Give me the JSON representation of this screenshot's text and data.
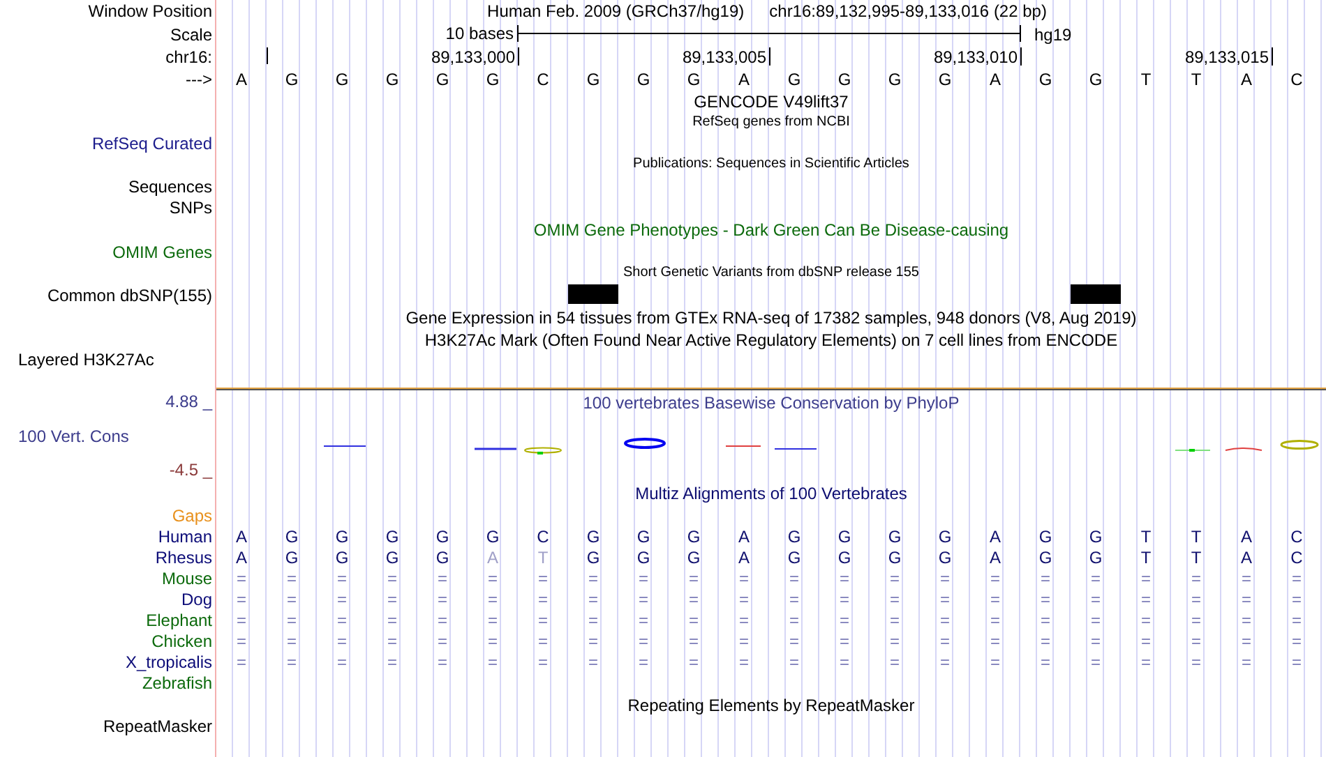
{
  "position_row": {
    "label": "Window Position",
    "assembly": "Human Feb. 2009 (GRCh37/hg19)",
    "range": "chr16:89,132,995-89,133,016 (22 bp)"
  },
  "scale_row": {
    "label": "Scale",
    "length": "10 bases",
    "assembly": "hg19"
  },
  "coordinate_row": {
    "label": "chr16:",
    "ticks": [
      "89,133,000",
      "89,133,005",
      "89,133,010",
      "89,133,015"
    ]
  },
  "sequence_row": {
    "label": "--->",
    "bases": [
      "A",
      "G",
      "G",
      "G",
      "G",
      "G",
      "C",
      "G",
      "G",
      "G",
      "A",
      "G",
      "G",
      "G",
      "G",
      "A",
      "G",
      "G",
      "T",
      "T",
      "A",
      "C"
    ]
  },
  "tracks": [
    {
      "kind": "title",
      "title": "GENCODE V49lift37",
      "color": "#000000"
    },
    {
      "kind": "small-title",
      "title": "RefSeq genes from NCBI",
      "color": "#000000"
    },
    {
      "kind": "label",
      "label": "RefSeq Curated",
      "color": "#1c1c8c"
    },
    {
      "kind": "small-title",
      "title": "Publications: Sequences in Scientific Articles",
      "color": "#000000"
    },
    {
      "kind": "label",
      "label": "Sequences",
      "color": "#000000"
    },
    {
      "kind": "label",
      "label": "SNPs",
      "color": "#000000"
    },
    {
      "kind": "title",
      "title": "OMIM Gene Phenotypes - Dark Green Can Be Disease-causing",
      "color": "#0c6a0c"
    },
    {
      "kind": "label",
      "label": "OMIM Genes",
      "color": "#0c6a0c"
    },
    {
      "kind": "small-title",
      "title": "Short Genetic Variants from dbSNP release 155",
      "color": "#000000"
    },
    {
      "kind": "variants",
      "label": "Common dbSNP(155)",
      "color": "#000000"
    },
    {
      "kind": "title",
      "title": "Gene Expression in 54 tissues from GTEx RNA-seq of 17382 samples, 948 donors (V8, Aug 2019)",
      "color": "#000000"
    },
    {
      "kind": "title",
      "title": "H3K27Ac Mark (Often Found Near Active Regulatory Elements) on 7 cell lines from ENCODE",
      "color": "#000000"
    },
    {
      "kind": "layered",
      "label": "Layered H3K27Ac",
      "color": "#000000"
    },
    {
      "kind": "axis-max",
      "label": "4.88 _",
      "title": "100 vertebrates Basewise Conservation by PhyloP",
      "color": "#3c3c8c"
    },
    {
      "kind": "conservation",
      "label": "100 Vert. Cons",
      "color": "#3c3c8c"
    },
    {
      "kind": "axis-min",
      "label": "-4.5 _",
      "color": "#8b3a3a"
    },
    {
      "kind": "title",
      "title": "Multiz Alignments of 100 Vertebrates",
      "color": "#0c0c70"
    },
    {
      "kind": "label",
      "label": "Gaps",
      "color": "#e8901c"
    },
    {
      "kind": "alignment",
      "label": "Human",
      "color": "#0c0c78",
      "bases": [
        {
          "base": "A",
          "mismatch": false
        },
        {
          "base": "G",
          "mismatch": false
        },
        {
          "base": "G",
          "mismatch": false
        },
        {
          "base": "G",
          "mismatch": false
        },
        {
          "base": "G",
          "mismatch": false
        },
        {
          "base": "G",
          "mismatch": false
        },
        {
          "base": "C",
          "mismatch": false
        },
        {
          "base": "G",
          "mismatch": false
        },
        {
          "base": "G",
          "mismatch": false
        },
        {
          "base": "G",
          "mismatch": false
        },
        {
          "base": "A",
          "mismatch": false
        },
        {
          "base": "G",
          "mismatch": false
        },
        {
          "base": "G",
          "mismatch": false
        },
        {
          "base": "G",
          "mismatch": false
        },
        {
          "base": "G",
          "mismatch": false
        },
        {
          "base": "A",
          "mismatch": false
        },
        {
          "base": "G",
          "mismatch": false
        },
        {
          "base": "G",
          "mismatch": false
        },
        {
          "base": "T",
          "mismatch": false
        },
        {
          "base": "T",
          "mismatch": false
        },
        {
          "base": "A",
          "mismatch": false
        },
        {
          "base": "C",
          "mismatch": false
        }
      ]
    },
    {
      "kind": "alignment",
      "label": "Rhesus",
      "color": "#0c0c78",
      "bases": [
        {
          "base": "A",
          "mismatch": false
        },
        {
          "base": "G",
          "mismatch": false
        },
        {
          "base": "G",
          "mismatch": false
        },
        {
          "base": "G",
          "mismatch": false
        },
        {
          "base": "G",
          "mismatch": false
        },
        {
          "base": "A",
          "mismatch": true
        },
        {
          "base": "T",
          "mismatch": true
        },
        {
          "base": "G",
          "mismatch": false
        },
        {
          "base": "G",
          "mismatch": false
        },
        {
          "base": "G",
          "mismatch": false
        },
        {
          "base": "A",
          "mismatch": false
        },
        {
          "base": "G",
          "mismatch": false
        },
        {
          "base": "G",
          "mismatch": false
        },
        {
          "base": "G",
          "mismatch": false
        },
        {
          "base": "G",
          "mismatch": false
        },
        {
          "base": "A",
          "mismatch": false
        },
        {
          "base": "G",
          "mismatch": false
        },
        {
          "base": "G",
          "mismatch": false
        },
        {
          "base": "T",
          "mismatch": false
        },
        {
          "base": "T",
          "mismatch": false
        },
        {
          "base": "A",
          "mismatch": false
        },
        {
          "base": "C",
          "mismatch": false
        }
      ]
    },
    {
      "kind": "alignment",
      "label": "Mouse",
      "color": "#0c6a0c",
      "bases": [
        {
          "base": "=",
          "mismatch": false
        },
        {
          "base": "=",
          "mismatch": false
        },
        {
          "base": "=",
          "mismatch": false
        },
        {
          "base": "=",
          "mismatch": false
        },
        {
          "base": "=",
          "mismatch": false
        },
        {
          "base": "=",
          "mismatch": false
        },
        {
          "base": "=",
          "mismatch": false
        },
        {
          "base": "=",
          "mismatch": false
        },
        {
          "base": "=",
          "mismatch": false
        },
        {
          "base": "=",
          "mismatch": false
        },
        {
          "base": "=",
          "mismatch": false
        },
        {
          "base": "=",
          "mismatch": false
        },
        {
          "base": "=",
          "mismatch": false
        },
        {
          "base": "=",
          "mismatch": false
        },
        {
          "base": "=",
          "mismatch": false
        },
        {
          "base": "=",
          "mismatch": false
        },
        {
          "base": "=",
          "mismatch": false
        },
        {
          "base": "=",
          "mismatch": false
        },
        {
          "base": "=",
          "mismatch": false
        },
        {
          "base": "=",
          "mismatch": false
        },
        {
          "base": "=",
          "mismatch": false
        },
        {
          "base": "=",
          "mismatch": false
        }
      ]
    },
    {
      "kind": "alignment",
      "label": "Dog",
      "color": "#0c0c78",
      "bases": [
        {
          "base": "=",
          "mismatch": false
        },
        {
          "base": "=",
          "mismatch": false
        },
        {
          "base": "=",
          "mismatch": false
        },
        {
          "base": "=",
          "mismatch": false
        },
        {
          "base": "=",
          "mismatch": false
        },
        {
          "base": "=",
          "mismatch": false
        },
        {
          "base": "=",
          "mismatch": false
        },
        {
          "base": "=",
          "mismatch": false
        },
        {
          "base": "=",
          "mismatch": false
        },
        {
          "base": "=",
          "mismatch": false
        },
        {
          "base": "=",
          "mismatch": false
        },
        {
          "base": "=",
          "mismatch": false
        },
        {
          "base": "=",
          "mismatch": false
        },
        {
          "base": "=",
          "mismatch": false
        },
        {
          "base": "=",
          "mismatch": false
        },
        {
          "base": "=",
          "mismatch": false
        },
        {
          "base": "=",
          "mismatch": false
        },
        {
          "base": "=",
          "mismatch": false
        },
        {
          "base": "=",
          "mismatch": false
        },
        {
          "base": "=",
          "mismatch": false
        },
        {
          "base": "=",
          "mismatch": false
        },
        {
          "base": "=",
          "mismatch": false
        }
      ]
    },
    {
      "kind": "alignment",
      "label": "Elephant",
      "color": "#0c6a0c",
      "bases": [
        {
          "base": "=",
          "mismatch": false
        },
        {
          "base": "=",
          "mismatch": false
        },
        {
          "base": "=",
          "mismatch": false
        },
        {
          "base": "=",
          "mismatch": false
        },
        {
          "base": "=",
          "mismatch": false
        },
        {
          "base": "=",
          "mismatch": false
        },
        {
          "base": "=",
          "mismatch": false
        },
        {
          "base": "=",
          "mismatch": false
        },
        {
          "base": "=",
          "mismatch": false
        },
        {
          "base": "=",
          "mismatch": false
        },
        {
          "base": "=",
          "mismatch": false
        },
        {
          "base": "=",
          "mismatch": false
        },
        {
          "base": "=",
          "mismatch": false
        },
        {
          "base": "=",
          "mismatch": false
        },
        {
          "base": "=",
          "mismatch": false
        },
        {
          "base": "=",
          "mismatch": false
        },
        {
          "base": "=",
          "mismatch": false
        },
        {
          "base": "=",
          "mismatch": false
        },
        {
          "base": "=",
          "mismatch": false
        },
        {
          "base": "=",
          "mismatch": false
        },
        {
          "base": "=",
          "mismatch": false
        },
        {
          "base": "=",
          "mismatch": false
        }
      ]
    },
    {
      "kind": "alignment",
      "label": "Chicken",
      "color": "#0c6a0c",
      "bases": [
        {
          "base": "=",
          "mismatch": false
        },
        {
          "base": "=",
          "mismatch": false
        },
        {
          "base": "=",
          "mismatch": false
        },
        {
          "base": "=",
          "mismatch": false
        },
        {
          "base": "=",
          "mismatch": false
        },
        {
          "base": "=",
          "mismatch": false
        },
        {
          "base": "=",
          "mismatch": false
        },
        {
          "base": "=",
          "mismatch": false
        },
        {
          "base": "=",
          "mismatch": false
        },
        {
          "base": "=",
          "mismatch": false
        },
        {
          "base": "=",
          "mismatch": false
        },
        {
          "base": "=",
          "mismatch": false
        },
        {
          "base": "=",
          "mismatch": false
        },
        {
          "base": "=",
          "mismatch": false
        },
        {
          "base": "=",
          "mismatch": false
        },
        {
          "base": "=",
          "mismatch": false
        },
        {
          "base": "=",
          "mismatch": false
        },
        {
          "base": "=",
          "mismatch": false
        },
        {
          "base": "=",
          "mismatch": false
        },
        {
          "base": "=",
          "mismatch": false
        },
        {
          "base": "=",
          "mismatch": false
        },
        {
          "base": "=",
          "mismatch": false
        }
      ]
    },
    {
      "kind": "alignment",
      "label": "X_tropicalis",
      "color": "#0c0c78",
      "bases": [
        {
          "base": "=",
          "mismatch": false
        },
        {
          "base": "=",
          "mismatch": false
        },
        {
          "base": "=",
          "mismatch": false
        },
        {
          "base": "=",
          "mismatch": false
        },
        {
          "base": "=",
          "mismatch": false
        },
        {
          "base": "=",
          "mismatch": false
        },
        {
          "base": "=",
          "mismatch": false
        },
        {
          "base": "=",
          "mismatch": false
        },
        {
          "base": "=",
          "mismatch": false
        },
        {
          "base": "=",
          "mismatch": false
        },
        {
          "base": "=",
          "mismatch": false
        },
        {
          "base": "=",
          "mismatch": false
        },
        {
          "base": "=",
          "mismatch": false
        },
        {
          "base": "=",
          "mismatch": false
        },
        {
          "base": "=",
          "mismatch": false
        },
        {
          "base": "=",
          "mismatch": false
        },
        {
          "base": "=",
          "mismatch": false
        },
        {
          "base": "=",
          "mismatch": false
        },
        {
          "base": "=",
          "mismatch": false
        },
        {
          "base": "=",
          "mismatch": false
        },
        {
          "base": "=",
          "mismatch": false
        },
        {
          "base": "=",
          "mismatch": false
        }
      ]
    },
    {
      "kind": "label",
      "label": "Zebrafish",
      "color": "#0c6a0c"
    },
    {
      "kind": "title",
      "title": "Repeating Elements by RepeatMasker",
      "color": "#000000"
    },
    {
      "kind": "label",
      "label": "RepeatMasker",
      "color": "#000000"
    }
  ]
}
